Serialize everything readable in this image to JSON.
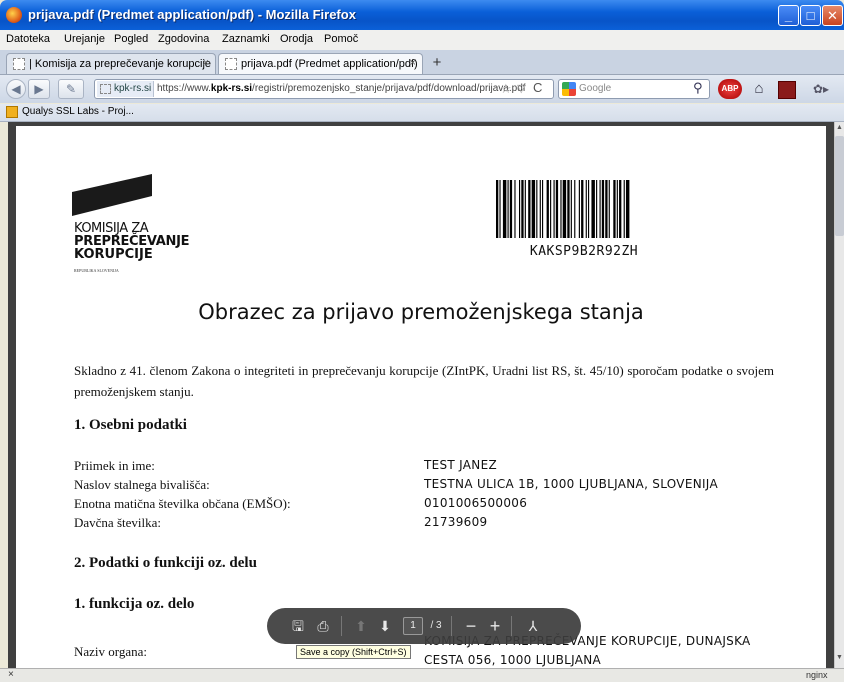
{
  "window": {
    "title": "prijava.pdf (Predmet application/pdf) - Mozilla Firefox"
  },
  "menu": {
    "items": [
      "Datoteka",
      "Urejanje",
      "Pogled",
      "Zgodovina",
      "Zaznamki",
      "Orodja",
      "Pomoč"
    ]
  },
  "tabs": [
    {
      "label": "| Komisija za preprečevanje korupcije"
    },
    {
      "label": "prijava.pdf (Predmet application/pdf)"
    }
  ],
  "tab_close": "×",
  "new_tab": "+",
  "nav": {
    "site_identity": "kpk-rs.si",
    "url_prefix": "https://www.",
    "url_domain": "kpk-rs.si",
    "url_path": "/registri/premozenjsko_stanje/prijava/pdf/download/prijava.pdf",
    "search_placeholder": "Google"
  },
  "bookmarks": {
    "item": "Qualys SSL Labs - Proj..."
  },
  "status": {
    "close": "×",
    "right": "nginx"
  },
  "document": {
    "logo_line1": "KOMISIJA ZA",
    "logo_line2": "PREPREČEVANJE",
    "logo_line3": "KORUPCIJE",
    "logo_small": "REPUBLIKA SLOVENIJA",
    "barcode_text": "KAKSP9B2R92ZH",
    "title": "Obrazec za prijavo premoženjskega stanja",
    "intro": "Skladno z 41. členom Zakona o integriteti in preprečevanju korupcije (ZIntPK, Uradni list RS, št. 45/10) sporočam podatke o svojem premoženjskem stanju.",
    "section1": "1. Osebni podatki",
    "fields": [
      {
        "label": "Priimek in ime:",
        "value": "TEST JANEZ"
      },
      {
        "label": "Naslov stalnega bivališča:",
        "value": "TESTNA ULICA 1B, 1000 LJUBLJANA, SLOVENIJA"
      },
      {
        "label": "Enotna matična številka občana (EMŠO):",
        "value": "0101006500006"
      },
      {
        "label": "Davčna številka:",
        "value": "21739609"
      }
    ],
    "section2": "2. Podatki o funkciji oz. delu",
    "subsection": "1. funkcija oz. delo",
    "organ_label": "Naziv organa:",
    "organ_value_line1": "KOMISIJA ZA PREPREČEVANJE KORUPCIJE, DUNAJSKA",
    "organ_value_line2": "CESTA 056, 1000 LJUBLJANA"
  },
  "pdf_toolbar": {
    "page_current": "1",
    "page_total": "/ 3",
    "tooltip": "Save a copy (Shift+Ctrl+S)"
  }
}
